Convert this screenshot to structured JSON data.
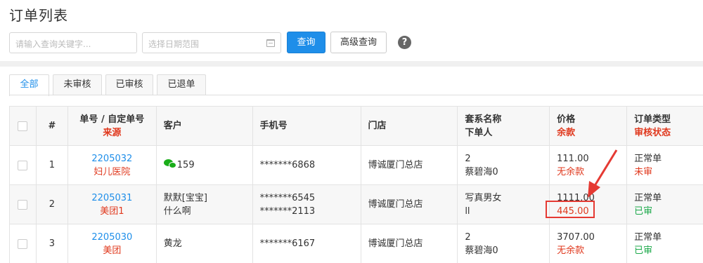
{
  "page": {
    "title": "订单列表"
  },
  "search": {
    "keyword_placeholder": "请输入查询关键字...",
    "date_placeholder": "选择日期范围",
    "query_button": "查询",
    "advanced_button": "高级查询",
    "help_symbol": "?"
  },
  "tabs": [
    {
      "label": "全部",
      "active": true
    },
    {
      "label": "未审核",
      "active": false
    },
    {
      "label": "已审核",
      "active": false
    },
    {
      "label": "已退单",
      "active": false
    }
  ],
  "table": {
    "headers": {
      "index": "#",
      "order_no": "单号 / 自定单号",
      "order_no_sub": "来源",
      "customer": "客户",
      "phone": "手机号",
      "store": "门店",
      "package": "套系名称",
      "package_sub": "下单人",
      "price": "价格",
      "price_sub": "余款",
      "order_type": "订单类型",
      "order_type_sub": "审核状态"
    },
    "rows": [
      {
        "index": "1",
        "order_no": "2205032",
        "source": "妇儿医院",
        "customer": "159",
        "customer_icon": "wechat-icon",
        "phone": "*******6868",
        "store": "博诚厦门总店",
        "package": "2",
        "creator": "蔡碧海0",
        "price": "111.00",
        "balance": "无余款",
        "type": "正常单",
        "status": "未审"
      },
      {
        "index": "2",
        "order_no": "2205031",
        "source": "美团1",
        "customer": "默默[宝宝]",
        "customer2": "什么啊",
        "phone": "*******6545",
        "phone2": "*******2113",
        "store": "博诚厦门总店",
        "package": "写真男女",
        "creator": "ll",
        "price": "1111.00",
        "balance": "445.00",
        "type": "正常单",
        "status": "已审"
      },
      {
        "index": "3",
        "order_no": "2205030",
        "source": "美团",
        "customer": "黄龙",
        "phone": "*******6167",
        "store": "博诚厦门总店",
        "package": "2",
        "creator": "蔡碧海0",
        "price": "3707.00",
        "balance": "无余款",
        "type": "正常单",
        "status": "已审"
      }
    ]
  },
  "colors": {
    "primary": "#1e8ee9",
    "red": "#e0391e",
    "green": "#1ca94a",
    "annotation": "#e53a33"
  }
}
